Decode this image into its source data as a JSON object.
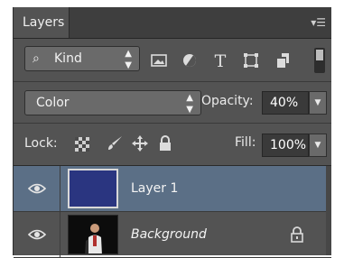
{
  "panel": {
    "tab_label": "Layers",
    "menu_icon": "panel-menu-icon"
  },
  "filter": {
    "kind_label": "Kind",
    "kind_stepper": "⇕",
    "icons": [
      "image-filter-icon",
      "adjustment-filter-icon",
      "type-filter-icon",
      "shape-filter-icon",
      "smart-object-filter-icon"
    ]
  },
  "blend": {
    "mode": "Color",
    "opacity_label": "Opacity:",
    "opacity_value": "40%"
  },
  "lock": {
    "label": "Lock:",
    "fill_label": "Fill:",
    "fill_value": "100%",
    "icons": [
      "lock-transparent-pixels-icon",
      "lock-image-pixels-icon",
      "lock-position-icon",
      "lock-all-icon"
    ]
  },
  "layers": [
    {
      "name": "Layer 1",
      "visible": true,
      "selected": true,
      "thumb_color": "#2a3580",
      "locked": false
    },
    {
      "name": "Background",
      "visible": true,
      "selected": false,
      "locked": true
    }
  ],
  "colors": {
    "panel_bg": "#535353",
    "selection": "#5b6f86",
    "field_bg": "#3a3a3a"
  }
}
